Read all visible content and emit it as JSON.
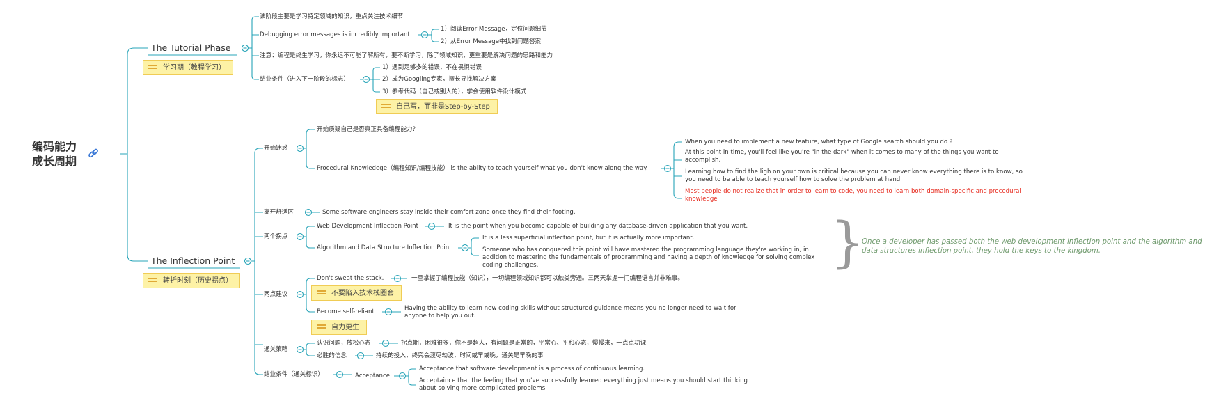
{
  "root": {
    "line1": "编码能力",
    "line2": "成长周期",
    "icon": "link-icon"
  },
  "tutorial": {
    "title": "The Tutorial Phase",
    "note": "学习期（教程学习）",
    "items": {
      "focus": "该阶段主要是学习特定领域的知识，重点关注技术细节",
      "debugging": "Debugging error messages is incredibly important",
      "debug_1": "1）阅读Error Message，定位问题细节",
      "debug_2": "2）从Error Message中找到问题答案",
      "note_lifelong": "注意：编程是终生学习，你永远不可能了解所有，要不断学习，除了领域知识，更重要是解决问题的思路和能力",
      "graduation": "结业条件（进入下一阶段的标志）",
      "grad_1": "1）遇到足够多的错误，不在畏惧错误",
      "grad_2": "2）成为Googling专家，擅长寻找解决方案",
      "grad_3": "3）参考代码（自己或别人的），学会使用软件设计模式",
      "grad_note": "自己写，而非是Step-by-Step"
    }
  },
  "inflection": {
    "title": "The Inflection Point",
    "note": "转折时刻（历史拐点）",
    "confused": {
      "label": "开始迷惑",
      "doubt": "开始质疑自己是否真正具备编程能力?",
      "procedural": "Procedural Knowledege（编程知识/编程技能） is the ablity to teach yourself what you don't know along the way.",
      "p1": "When you need to implement a new feature, what type of Google search should you do ?",
      "p2": "At this point in time, you'll feel like you're \"in the dark\" when it comes to many of the things you want to accomplish.",
      "p3": "Learning how to find the ligh on your own is critical because you can never know everything there is to know, so you need to be able to teach yourself how to solve the problem at hand",
      "p4": "Most people do not realize that in order to learn to code, you need to learn both domain-specific and procedural knowledge"
    },
    "comfort": {
      "label": "离开舒适区",
      "text": "Some software engineers stay inside their comfort zone once they find their footing."
    },
    "two_points": {
      "label": "两个拐点",
      "web": "Web Development Inflection Point",
      "web_text": "It is the point when you become capable of building any database-driven application that you want.",
      "algo": "Algorithm and Data Structure Inflection Point",
      "algo_1": "It is a less superficial inflection point, but it is actually more important.",
      "algo_2": "Someone who has conquered this point will have mastered the programming language they're working in, in addition to mastering the fundamentals of programming and having a depth of knowledge for solving complex coding challenges.",
      "summary": "Once a developer has passed both the web development inflection point and the algorithm and data structures inflection point, they hold the keys to the kingdom."
    },
    "advice": {
      "label": "两点建议",
      "stack": "Don't sweat the stack.",
      "stack_text": "一旦掌握了编程技能（知识），一切编程领域知识都可以触类旁通。三两天掌握一门编程语言并非难事。",
      "stack_note": "不要陷入技术栈圈套",
      "self": "Become self-reliant",
      "self_text": "Having the ability to learn new coding skills without structured guidance means you no longer need to wait for anyone to help you out.",
      "self_note": "自力更生"
    },
    "strategy": {
      "label": "通关策略",
      "s1": "认识问题，放松心态",
      "s1_text": "拐点期，困难很多，你不是超人，有问题是正常的，平常心、平和心态，慢慢来，一点点功课",
      "s2": "必胜的信念",
      "s2_text": "持续的投入，终究会渡尽劫波，时间或早或晚，通关是早晚的事"
    },
    "graduation": {
      "label": "结业条件（通关标识）",
      "acceptance": "Acceptance",
      "a1": "Acceptance that software development is a process of continuous learning.",
      "a2": "Acceptaince that the feeling that you've successfully leanred everything just means you should start thinking about solving more complicated problems"
    }
  },
  "colors": {
    "line": "#27a4b8",
    "note_bg": "#fdf2a6",
    "note_border": "#f0cc55",
    "red": "#e6281c",
    "summary": "#6f9a6d"
  }
}
